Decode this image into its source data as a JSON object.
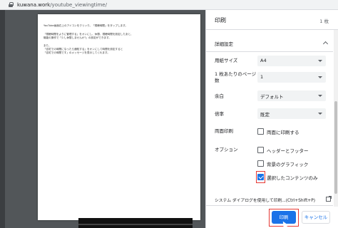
{
  "browser": {
    "url_host": "kuwana.work",
    "url_path": "/youtube_viewingtime/"
  },
  "preview": {
    "lines": [
      "YouTube画面右上のアイコンをクリック。「視聴時間」をタップします。",
      "",
      "「視聴時間をよりに管理する」をオンにし、休憩、視聴時間を設定したあと、",
      "機能の操作で「少し休憩しませんか?」の設定ができます。",
      "",
      "また、",
      "「自宅での時間になったら通知する」をオンにして時間を設定すると",
      "「自宅での時間です」のメッセージを表示してくれます。"
    ]
  },
  "dialog": {
    "title": "印刷",
    "sheet_count": "1 枚",
    "advanced_label": "詳細設定",
    "paper_size_label": "用紙サイズ",
    "paper_size_value": "A4",
    "pages_per_sheet_label_1": "1 枚あたりのページ",
    "pages_per_sheet_label_2": "数",
    "pages_per_sheet_value": "1",
    "margins_label": "余白",
    "margins_value": "デフォルト",
    "scale_label": "倍率",
    "scale_value": "既定",
    "two_sided_label": "両面印刷",
    "two_sided_option": "両面に印刷する",
    "options_label": "オプション",
    "option_header_footer": "ヘッダーとフッター",
    "option_background": "背景のグラフィック",
    "option_selection_only": "選択したコンテンツのみ",
    "system_dialog_text": "システム ダイアログを使用して印刷...(Ctrl+Shift+P)",
    "print_button": "印刷",
    "cancel_button": "キャンセル"
  },
  "colors": {
    "accent": "#1a73e8",
    "highlight": "#e53935"
  }
}
